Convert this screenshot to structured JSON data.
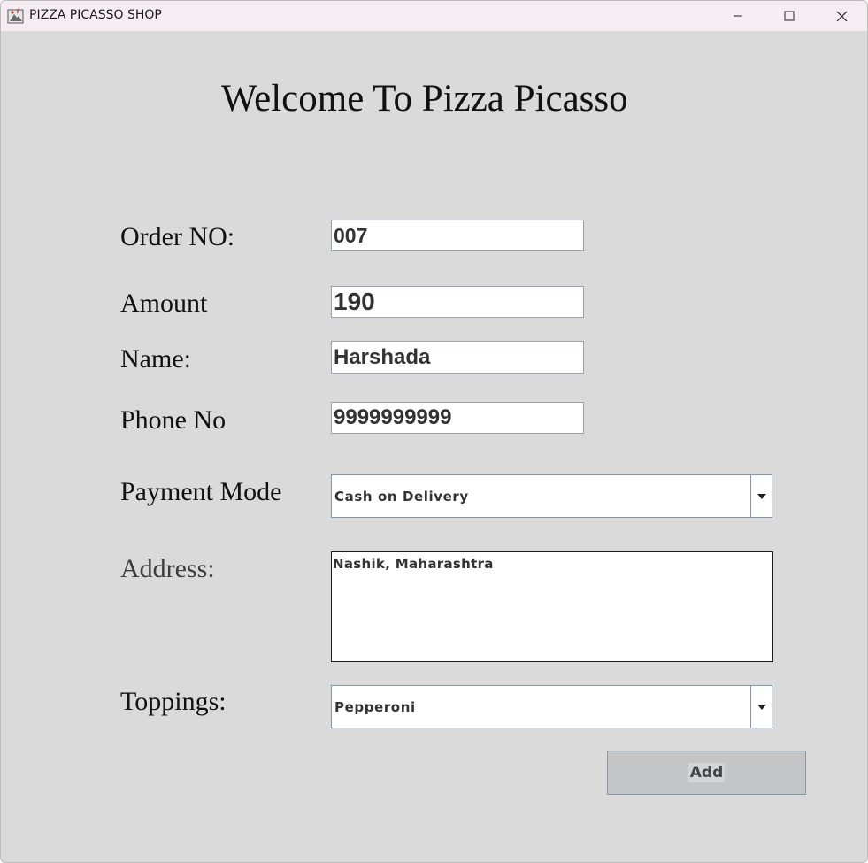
{
  "window": {
    "title": "PIZZA PICASSO SHOP",
    "icon": "java-app-icon",
    "controls": [
      "minimize-icon",
      "maximize-icon",
      "close-icon"
    ]
  },
  "form": {
    "heading": "Welcome To Pizza Picasso",
    "order_no": {
      "label": "Order NO:",
      "value": "007"
    },
    "amount": {
      "label": "Amount",
      "value": "190"
    },
    "name": {
      "label": "Name:",
      "value": "Harshada"
    },
    "phone": {
      "label": "Phone No",
      "value": "9999999999"
    },
    "payment_mode": {
      "label": "Payment Mode",
      "selected": "Cash on Delivery"
    },
    "address": {
      "label": "Address:",
      "value": "Nashik, Maharashtra"
    },
    "toppings": {
      "label": "Toppings:",
      "selected": "Pepperoni"
    },
    "add_button": {
      "label": "Add"
    }
  },
  "colors": {
    "window_background": "#dadada",
    "titlebar_background": "#f6edf3",
    "field_border": "#9aa3ad",
    "button_background": "#c4c5c7"
  }
}
